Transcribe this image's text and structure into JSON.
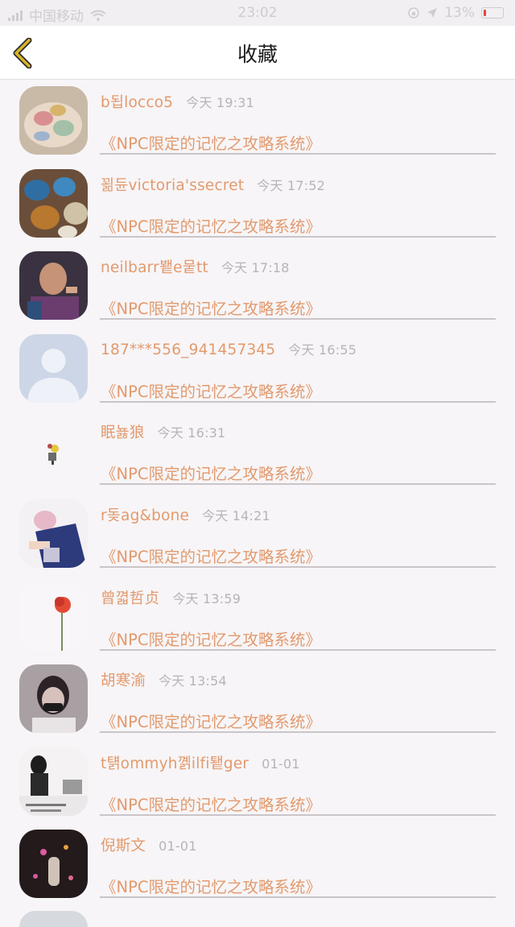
{
  "status_bar": {
    "carrier": "中国移动",
    "time": "23:02",
    "battery": "13%",
    "battery_level": 0.13,
    "colors": {
      "battery_low": "#e2443d"
    }
  },
  "header": {
    "title": "收藏",
    "back_icon": "chevron-left-icon",
    "accent": "#d9b42a"
  },
  "list": {
    "text_color": "#e29a6e",
    "time_color": "#b8b3b8",
    "items": [
      {
        "user": "b됩locco5",
        "time": "今天 19:31",
        "book": "《NPC限定的记忆之攻略系统》"
      },
      {
        "user": "꾊듄victoria'ssecret",
        "time": "今天 17:52",
        "book": "《NPC限定的记忆之攻略系统》"
      },
      {
        "user": "neilbarr뵅e뭍tt",
        "time": "今天 17:18",
        "book": "《NPC限定的记忆之攻略系统》"
      },
      {
        "user": "187***556_941457345",
        "time": "今天 16:55",
        "book": "《NPC限定的记忆之攻略系统》"
      },
      {
        "user": "眠뇷狼",
        "time": "今天 16:31",
        "book": "《NPC限定的记忆之攻略系统》"
      },
      {
        "user": "r돚ag&bone",
        "time": "今天 14:21",
        "book": "《NPC限定的记忆之攻略系统》"
      },
      {
        "user": "曾껿哲贞",
        "time": "今天 13:59",
        "book": "《NPC限定的记忆之攻略系统》"
      },
      {
        "user": "胡寒渝",
        "time": "今天 13:54",
        "book": "《NPC限定的记忆之攻略系统》"
      },
      {
        "user": "t턝ommyh꼙ilfi퇱ger",
        "time": "01-01",
        "book": "《NPC限定的记忆之攻略系统》"
      },
      {
        "user": "倪斯文",
        "time": "01-01",
        "book": "《NPC限定的记忆之攻略系统》"
      }
    ]
  }
}
